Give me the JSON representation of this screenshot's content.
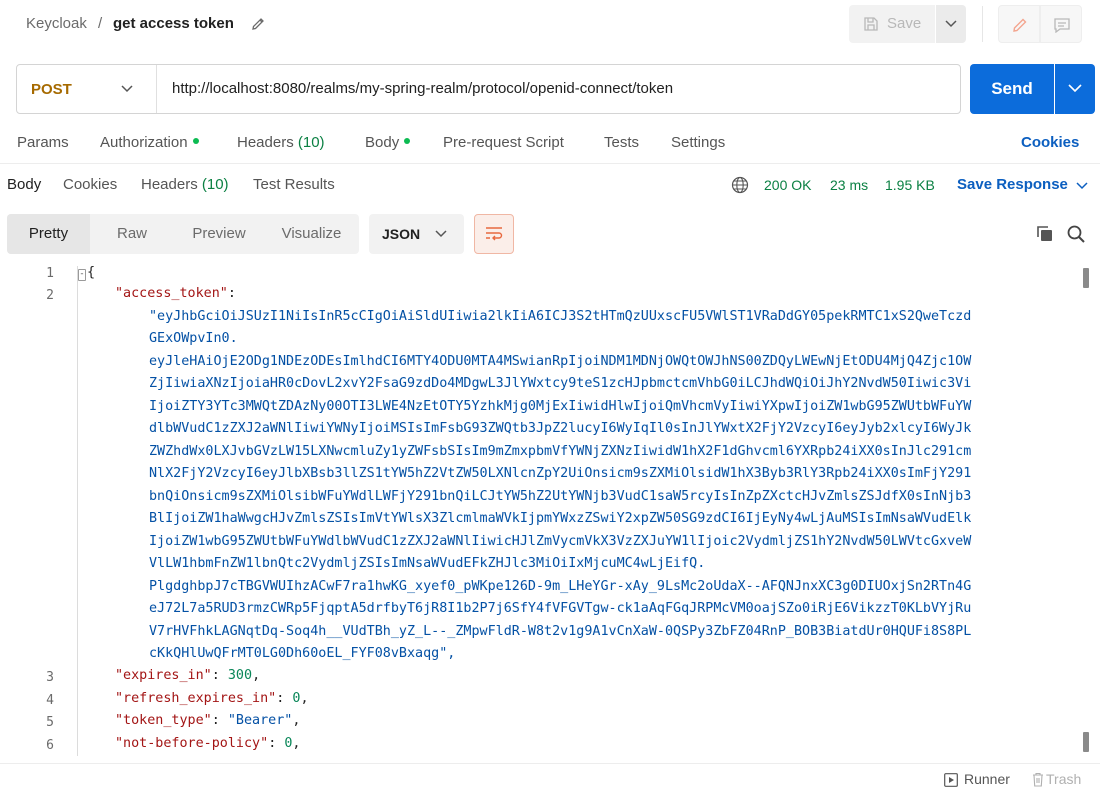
{
  "header": {
    "breadcrumb_parent": "Keycloak",
    "breadcrumb_separator": "/",
    "request_name": "get access token",
    "save_label": "Save"
  },
  "request": {
    "method": "POST",
    "url": "http://localhost:8080/realms/my-spring-realm/protocol/openid-connect/token",
    "send_label": "Send"
  },
  "request_tabs": {
    "params": "Params",
    "authorization": "Authorization",
    "headers": "Headers",
    "headers_count": "(10)",
    "body": "Body",
    "prerequest": "Pre-request Script",
    "tests": "Tests",
    "settings": "Settings",
    "cookies": "Cookies"
  },
  "response_tabs": {
    "body": "Body",
    "cookies": "Cookies",
    "headers": "Headers",
    "headers_count": "(10)",
    "test_results": "Test Results"
  },
  "response_meta": {
    "status": "200 OK",
    "time": "23 ms",
    "size": "1.95 KB",
    "save_response": "Save Response"
  },
  "view_modes": [
    "Pretty",
    "Raw",
    "Preview",
    "Visualize"
  ],
  "format": "JSON",
  "code": {
    "line_numbers": [
      "1",
      "2",
      "3",
      "4",
      "5",
      "6"
    ],
    "open_brace": "{",
    "access_token_key": "\"access_token\"",
    "token_lines": [
      "\"eyJhbGciOiJSUzI1NiIsInR5cCIgOiAiSldUIiwia2lkIiA6ICJ3S2tHTmQzUUxscFU5VWlST1VRaDdGY05pekRMTC1xS2QweTczd",
      "GExOWpvIn0.",
      "eyJleHAiOjE2ODg1NDEzODEsImlhdCI6MTY4ODU0MTA4MSwianRpIjoiNDM1MDNjOWQtOWJhNS00ZDQyLWEwNjEtODU4MjQ4Zjc1OW",
      "ZjIiwiaXNzIjoiaHR0cDovL2xvY2FsaG9zdDo4MDgwL3JlYWxtcy9teS1zcHJpbmctcmVhbG0iLCJhdWQiOiJhY2NvdW50Iiwic3Vi",
      "IjoiZTY3YTc3MWQtZDAzNy00OTI3LWE4NzEtOTY5YzhkMjg0MjExIiwidHlwIjoiQmVhcmVyIiwiYXpwIjoiZW1wbG95ZWUtbWFuYW",
      "dlbWVudC1zZXJ2aWNlIiwiYWNyIjoiMSIsImFsbG93ZWQtb3JpZ2lucyI6WyIqIl0sInJlYWxtX2FjY2VzcyI6eyJyb2xlcyI6WyJk",
      "ZWZhdWx0LXJvbGVzLW15LXNwcmluZy1yZWFsbSIsIm9mZmxpbmVfYWNjZXNzIiwidW1hX2F1dGhvcml6YXRpb24iXX0sInJlc291cm",
      "NlX2FjY2VzcyI6eyJlbXBsb3llZS1tYW5hZ2VtZW50LXNlcnZpY2UiOnsicm9sZXMiOlsidW1hX3Byb3RlY3Rpb24iXX0sImFjY291",
      "bnQiOnsicm9sZXMiOlsibWFuYWdlLWFjY291bnQiLCJtYW5hZ2UtYWNjb3VudC1saW5rcyIsInZpZXctcHJvZmlsZSJdfX0sInNjb3",
      "BlIjoiZW1haWwgcHJvZmlsZSIsImVtYWlsX3ZlcmlmaWVkIjpmYWxzZSwiY2xpZW50SG9zdCI6IjEyNy4wLjAuMSIsImNsaWVudElk",
      "IjoiZW1wbG95ZWUtbWFuYWdlbWVudC1zZXJ2aWNlIiwicHJlZmVycmVkX3VzZXJuYW1lIjoic2VydmljZS1hY2NvdW50LWVtcGxveW",
      "VlLW1hbmFnZW1lbnQtc2VydmljZSIsImNsaWVudEFkZHJlc3MiOiIxMjcuMC4wLjEifQ.",
      "PlgdghbpJ7cTBGVWUIhzACwF7ra1hwKG_xyef0_pWKpe126D-9m_LHeYGr-xAy_9LsMc2oUdaX--AFQNJnxXC3g0DIUOxjSn2RTn4G",
      "eJ72L7a5RUD3rmzCWRp5FjqptA5drfbyT6jR8I1b2P7j6SfY4fVFGVTgw-ck1aAqFGqJRPMcVM0oajSZo0iRjE6VikzzT0KLbVYjRu",
      "V7rHVFhkLAGNqtDq-Soq4h__VUdTBh_yZ_L--_ZMpwFldR-W8t2v1g9A1vCnXaW-0QSPy3ZbFZ04RnP_BOB3BiatdUr0HQUFi8S8PL",
      "cKkQHlUwQFrMT0LG0Dh60oEL_FYF08vBxaqg\","
    ],
    "expires_in_key": "\"expires_in\"",
    "expires_in_val": "300",
    "refresh_key": "\"refresh_expires_in\"",
    "refresh_val": "0",
    "token_type_key": "\"token_type\"",
    "token_type_val": "\"Bearer\"",
    "nbf_key": "\"not-before-policy\"",
    "nbf_val": "0",
    "colon": ": ",
    "comma": ","
  },
  "footer": {
    "runner": "Runner",
    "trash": "Trash"
  }
}
